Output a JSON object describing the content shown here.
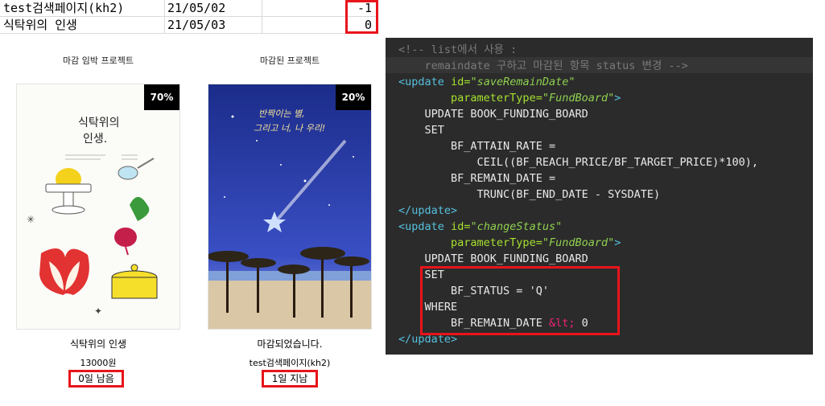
{
  "spreadsheet": {
    "rows": [
      {
        "name": "test검색페이지(kh2)",
        "date": "21/05/02",
        "value": "-1"
      },
      {
        "name": "식탁위의 인생",
        "date": "21/05/03",
        "value": "0"
      }
    ]
  },
  "cards": {
    "left": {
      "section_label": "마감 임박 프로젝트",
      "percent": "70%",
      "cover_title": "식탁위의\n인생.",
      "title": "식탁위의 인생",
      "subtitle": "13000원",
      "badge": "0일 남음"
    },
    "right": {
      "section_label": "마감된 프로젝트",
      "percent": "20%",
      "cover_title": "반짝이는 별,\n그리고 너, 나 우리!",
      "title": "마감되었습니다.",
      "subtitle": "test검색페이지(kh2)",
      "badge": "1일 지남"
    }
  },
  "code": {
    "comment1": "<!-- list에서 사용 :",
    "comment2": "remaindate 구하고 마감된 항목 status 변경 -->",
    "update1_id": "\"saveRemainDate\"",
    "update1_param": "\"FundBoard\"",
    "update2_id": "\"changeStatus\"",
    "update2_param": "\"FundBoard\"",
    "l_update_table": "UPDATE BOOK_FUNDING_BOARD",
    "l_set": "SET",
    "l_attain": "BF_ATTAIN_RATE =",
    "l_ceil": "CEIL((BF_REACH_PRICE/BF_TARGET_PRICE)*100),",
    "l_remain": "BF_REMAIN_DATE =",
    "l_trunc": "TRUNC(BF_END_DATE - SYSDATE)",
    "l_status": "BF_STATUS = 'Q'",
    "l_where": "WHERE",
    "l_remain_cond": "BF_REMAIN_DATE ",
    "l_lt": "&lt;",
    "l_zero": " 0",
    "kw_update": "update",
    "kw_id": "id=",
    "kw_param": "parameterType="
  },
  "colors": {
    "highlight_red": "#e8141b",
    "editor_bg": "#2b2b2b"
  }
}
